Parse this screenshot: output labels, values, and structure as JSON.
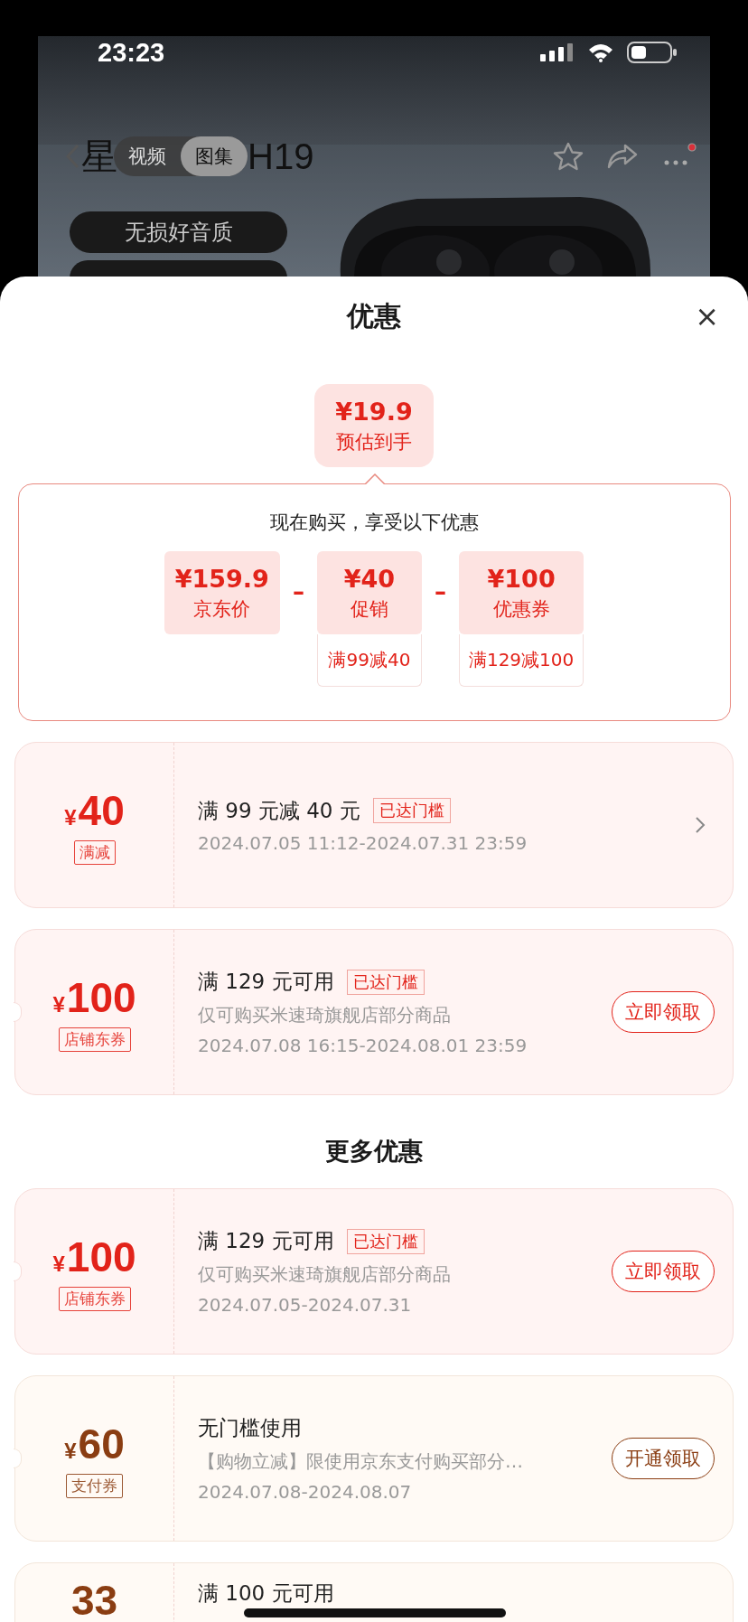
{
  "status_bar": {
    "time": "23:23"
  },
  "product_header": {
    "title_start": "星",
    "title_end": "H19",
    "tabs": [
      {
        "label": "视频",
        "selected": false
      },
      {
        "label": "图集",
        "selected": true
      }
    ],
    "has_notification": true,
    "features": [
      "无损好音质"
    ]
  },
  "sheet": {
    "title": "优惠",
    "close": "×"
  },
  "estimate": {
    "price": "¥19.9",
    "label": "预估到手"
  },
  "breakdown": {
    "heading": "现在购买，享受以下优惠",
    "items": [
      {
        "amount": "¥159.9",
        "label": "京东价"
      },
      {
        "op": "–",
        "amount": "¥40",
        "label": "促销",
        "condition": "满99减40"
      },
      {
        "op": "–",
        "amount": "¥100",
        "label": "优惠券",
        "condition": "满129减100"
      }
    ]
  },
  "coupons": [
    {
      "kind": "discount",
      "currency": "¥",
      "amount": "40",
      "tag": "满减",
      "title": "满 99 元减 40 元",
      "badge": "已达门槛",
      "date": "2024.07.05 11:12-2024.07.31 23:59",
      "action": {
        "kind": "chevron"
      }
    },
    {
      "kind": "store",
      "currency": "¥",
      "amount": "100",
      "tag": "店铺东券",
      "title": "满 129 元可用",
      "badge": "已达门槛",
      "desc": "仅可购买米速琦旗舰店部分商品",
      "date": "2024.07.08 16:15-2024.08.01 23:59",
      "action": {
        "kind": "button",
        "label": "立即领取"
      }
    }
  ],
  "more": {
    "title": "更多优惠",
    "coupons": [
      {
        "kind": "store",
        "currency": "¥",
        "amount": "100",
        "tag": "店铺东券",
        "title": "满 129 元可用",
        "badge": "已达门槛",
        "desc": "仅可购买米速琦旗舰店部分商品",
        "date": "2024.07.05-2024.07.31",
        "action": {
          "kind": "button",
          "label": "立即领取"
        }
      },
      {
        "kind": "payment",
        "currency": "¥",
        "amount": "60",
        "tag": "支付券",
        "title": "无门槛使用",
        "desc": "【购物立减】限使用京东支付购买部分…",
        "date": "2024.07.08-2024.08.07",
        "action": {
          "kind": "button",
          "label": "开通领取"
        }
      },
      {
        "kind": "payment",
        "amount": "33",
        "title": "满 100 元可用",
        "action": {
          "kind": "none"
        }
      }
    ]
  }
}
